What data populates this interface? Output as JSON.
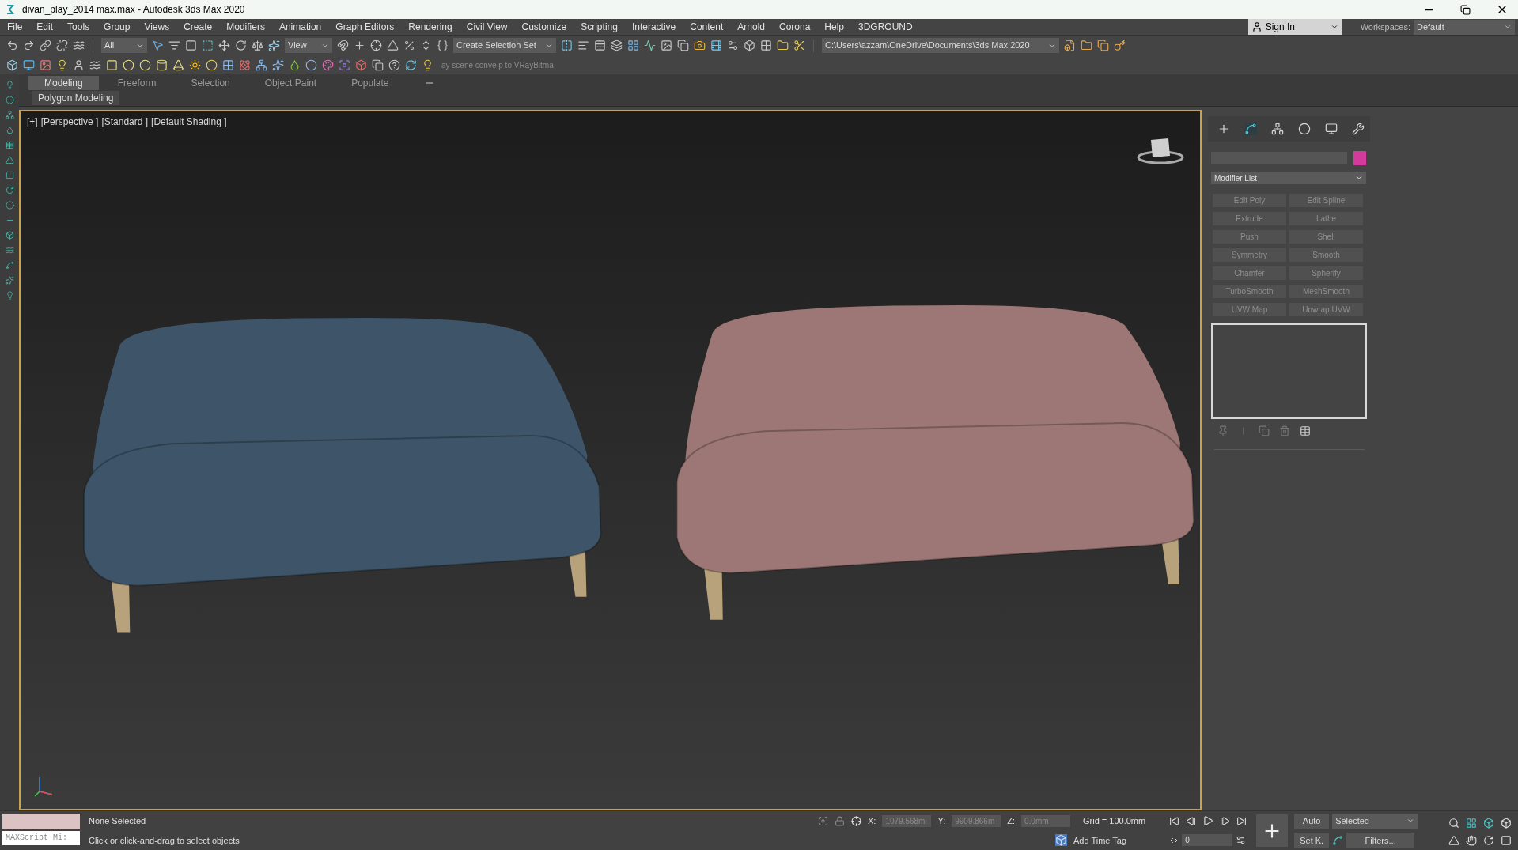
{
  "window": {
    "title": "divan_play_2014 max.max - Autodesk 3ds Max 2020"
  },
  "menu": [
    "File",
    "Edit",
    "Tools",
    "Group",
    "Views",
    "Create",
    "Modifiers",
    "Animation",
    "Graph Editors",
    "Rendering",
    "Civil View",
    "Customize",
    "Scripting",
    "Interactive",
    "Content",
    "Arnold",
    "Corona",
    "Help",
    "3DGROUND"
  ],
  "account": {
    "label": "Sign In"
  },
  "workspaces": {
    "label": "Workspaces:",
    "value": "Default"
  },
  "toolbar": {
    "selection_filter": "All",
    "reference_coord": "View",
    "selection_set": "Create Selection Set",
    "project_path": "C:\\Users\\azzam\\OneDrive\\Documents\\3ds Max 2020"
  },
  "script_hint": "ay scene conve p to VRayBitma",
  "ribbon": {
    "tabs": [
      {
        "label": "Modeling",
        "selected": true
      },
      {
        "label": "Freeform",
        "selected": false
      },
      {
        "label": "Selection",
        "selected": false
      },
      {
        "label": "Object Paint",
        "selected": false
      },
      {
        "label": "Populate",
        "selected": false
      }
    ],
    "panel": "Polygon Modeling"
  },
  "viewport": {
    "labels": [
      "[+]",
      "[Perspective ]",
      "[Standard ]",
      "[Default Shading ]"
    ]
  },
  "command_panel": {
    "tabs": [
      {
        "kind": "create",
        "selected": false
      },
      {
        "kind": "modify",
        "selected": true
      },
      {
        "kind": "hierarchy",
        "selected": false
      },
      {
        "kind": "motion",
        "selected": false
      },
      {
        "kind": "display",
        "selected": false
      },
      {
        "kind": "utilities",
        "selected": false
      }
    ],
    "modifier_list": "Modifier List",
    "modifiers": [
      "Edit Poly",
      "Edit Spline",
      "Extrude",
      "Lathe",
      "Push",
      "Shell",
      "Symmetry",
      "Smooth",
      "Chamfer",
      "Spherify",
      "TurboSmooth",
      "MeshSmooth",
      "UVW Map",
      "Unwrap UVW"
    ]
  },
  "status": {
    "maxscript": "MAXScript Mi:",
    "selection": "None Selected",
    "prompt": "Click or click-and-drag to select objects"
  },
  "coords": [
    {
      "label": "X:",
      "value": "1079.568m"
    },
    {
      "label": "Y:",
      "value": "9909.866m"
    },
    {
      "label": "Z:",
      "value": "0.0mm"
    }
  ],
  "grid": "Grid = 100.0mm",
  "time_tag": "Add Time Tag",
  "frame": "0",
  "key": {
    "auto": "Auto",
    "set": "Set K.",
    "mode": "Selected",
    "filters": "Filters..."
  }
}
